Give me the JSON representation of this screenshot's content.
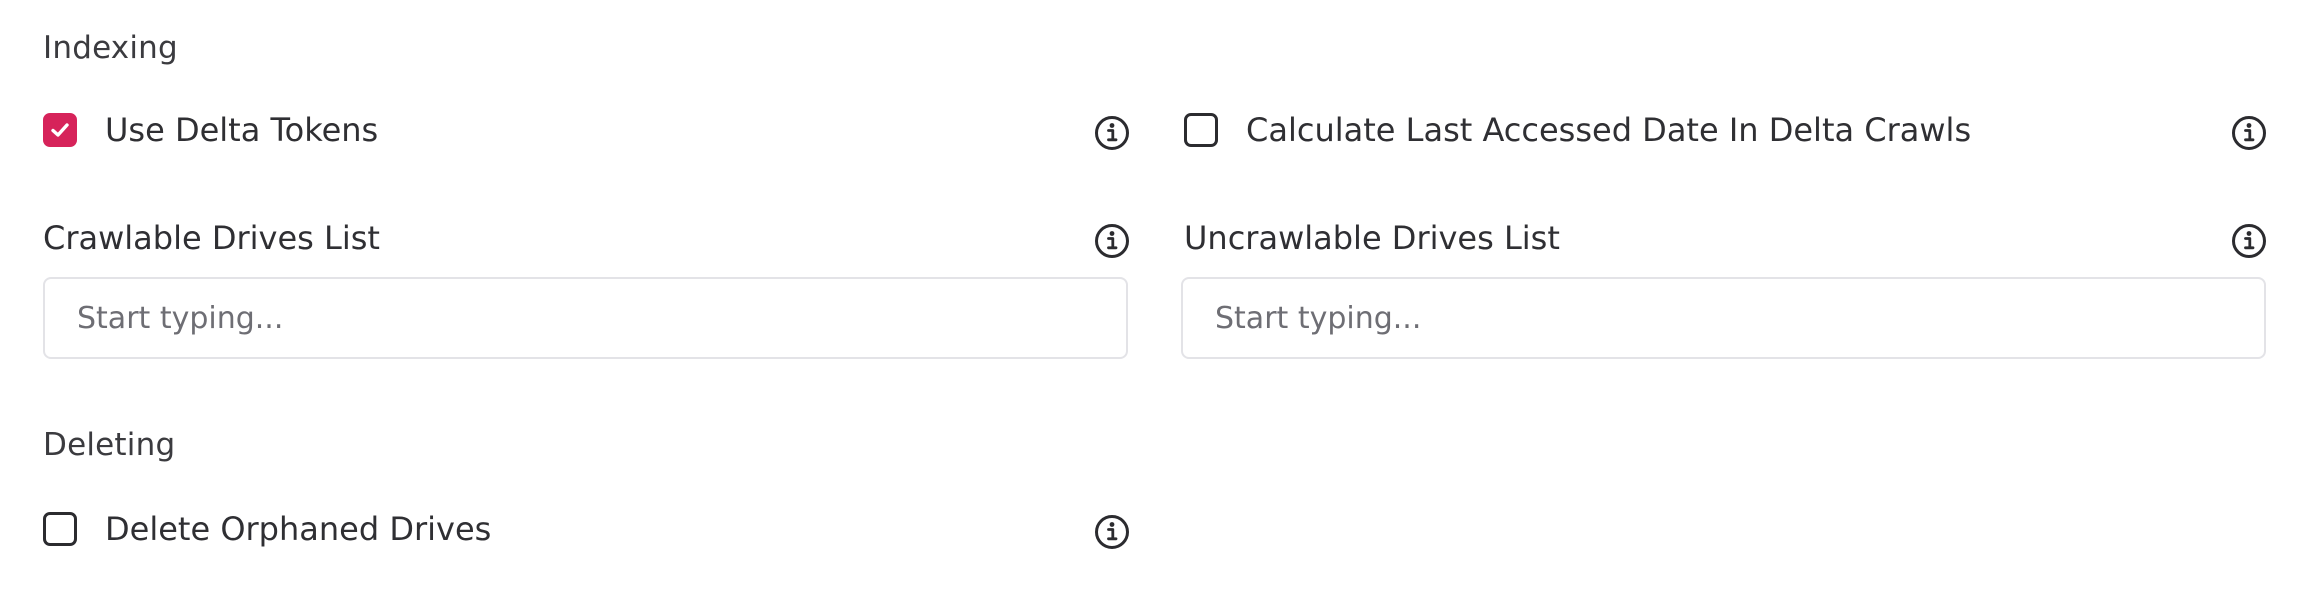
{
  "indexing": {
    "title": "Indexing",
    "use_delta_tokens": {
      "label": "Use Delta Tokens",
      "checked": true
    },
    "calculate_last_accessed": {
      "label": "Calculate Last Accessed Date In Delta Crawls",
      "checked": false
    },
    "crawlable_drives": {
      "label": "Crawlable Drives List",
      "value": "",
      "placeholder": "Start typing..."
    },
    "uncrawlable_drives": {
      "label": "Uncrawlable Drives List",
      "value": "",
      "placeholder": "Start typing..."
    }
  },
  "deleting": {
    "title": "Deleting",
    "delete_orphaned_drives": {
      "label": "Delete Orphaned Drives",
      "checked": false
    }
  },
  "colors": {
    "accent": "#d6235a",
    "border": "#e3e3e7",
    "text": "#2f2f33"
  },
  "icons": {
    "info": "info-circle-icon",
    "check": "checkmark-icon"
  }
}
